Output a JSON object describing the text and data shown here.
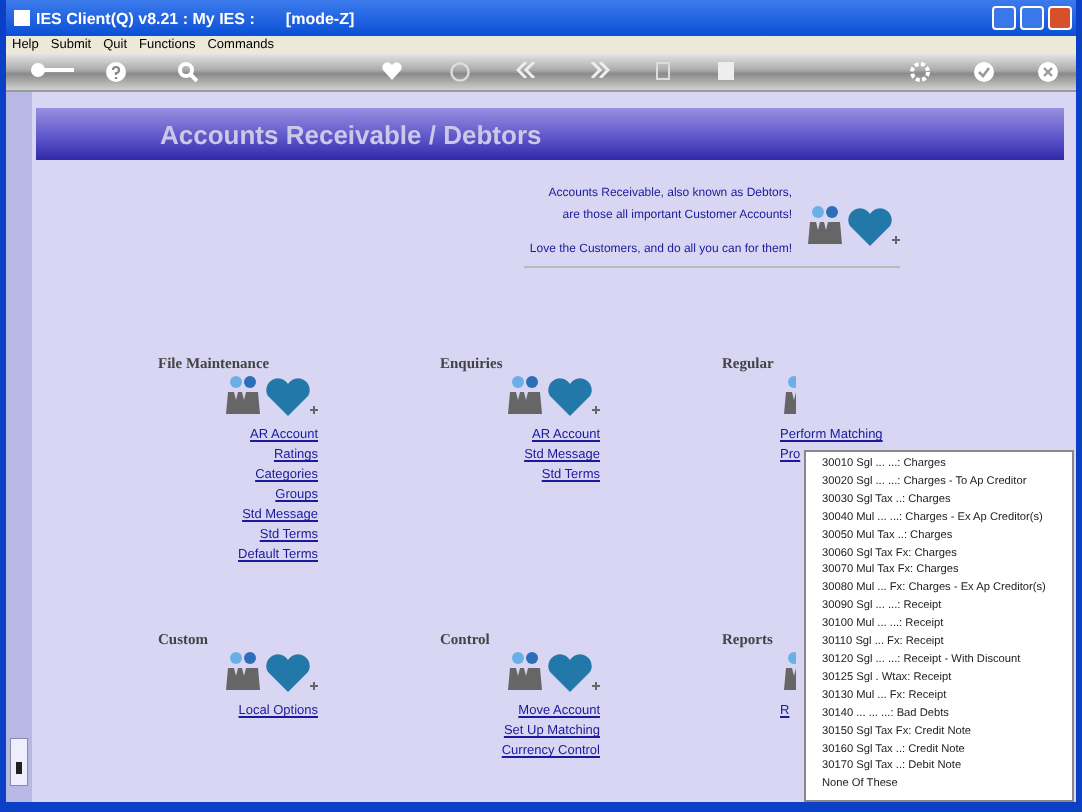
{
  "window": {
    "title": "IES Client(Q) v8.21 : My IES :       [mode-Z]"
  },
  "menu": [
    "Help",
    "Submit",
    "Quit",
    "Functions",
    "Commands"
  ],
  "header": {
    "title": "Accounts Receivable / Debtors"
  },
  "intro": [
    "Accounts Receivable, also known as Debtors,",
    "are those  all important Customer Accounts!",
    "Love the Customers, and do all you can for them!"
  ],
  "sections": [
    {
      "heading": "File Maintenance",
      "links": [
        "AR Account",
        "Ratings",
        "Categories",
        "Groups",
        "Std Message",
        "Std Terms",
        "Default Terms"
      ]
    },
    {
      "heading": "Enquiries",
      "links": [
        "AR Account",
        "Std Message",
        "Std Terms"
      ]
    },
    {
      "heading": "Regular",
      "links": [
        "Perform Matching",
        "Pro"
      ]
    },
    {
      "heading": "Custom",
      "links": [
        "Local Options"
      ]
    },
    {
      "heading": "Control",
      "links": [
        "Move Account",
        "Set Up Matching",
        "Currency Control"
      ]
    },
    {
      "heading": "Reports",
      "links": [
        "R"
      ]
    }
  ],
  "popup": [
    "30010 Sgl ... ...: Charges",
    "30020 Sgl ... ...: Charges - To Ap Creditor",
    "30030 Sgl Tax ..: Charges",
    "30040 Mul ... ...: Charges - Ex Ap Creditor(s)",
    "30050 Mul Tax ..: Charges",
    "30060 Sgl Tax Fx: Charges",
    "30070 Mul Tax Fx: Charges",
    "30080 Mul ... Fx: Charges - Ex Ap Creditor(s)",
    "30090 Sgl ... ...: Receipt",
    "30100 Mul ... ...: Receipt",
    "30110 Sgl ... Fx: Receipt",
    "30120 Sgl ... ...: Receipt - With Discount",
    "30125 Sgl . Wtax: Receipt",
    "30130 Mul ... Fx: Receipt",
    "30140 ... ... ...: Bad Debts",
    "30150 Sgl Tax Fx: Credit Note",
    "30160 Sgl Tax ..: Credit Note",
    "30170 Sgl Tax ..: Debit Note",
    "None Of These"
  ]
}
